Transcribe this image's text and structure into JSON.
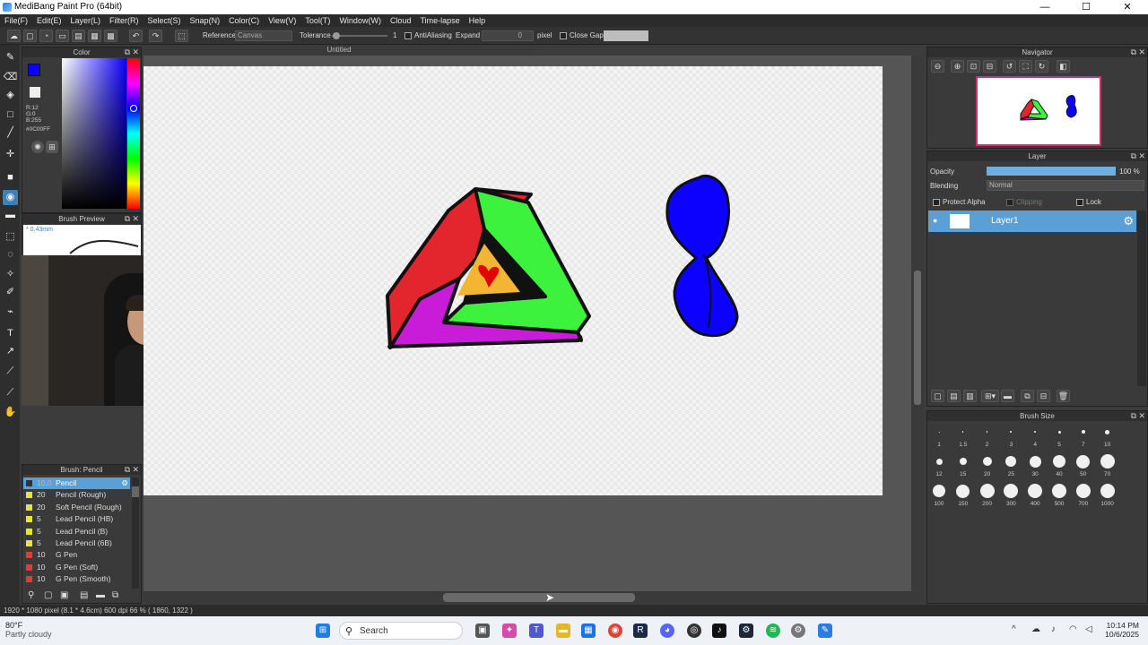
{
  "window": {
    "title": "MediBang Paint Pro (64bit)",
    "min": "—",
    "max": "☐",
    "close": "✕"
  },
  "menu": [
    "File(F)",
    "Edit(E)",
    "Layer(L)",
    "Filter(R)",
    "Select(S)",
    "Snap(N)",
    "Color(C)",
    "View(V)",
    "Tool(T)",
    "Window(W)",
    "Cloud",
    "Time-lapse",
    "Help"
  ],
  "toolbar": {
    "reference_label": "Reference",
    "reference_value": "Canvas",
    "tolerance_label": "Tolerance",
    "tolerance_value": "1",
    "antialiasing_label": "AntiAliasing",
    "expand_label": "Expand",
    "expand_value": "0",
    "expand_unit": "pixel",
    "close_gaps_label": "Close Gaps"
  },
  "color_panel": {
    "title": "Color",
    "r": "R:12",
    "g": "G:0",
    "b": "B:255",
    "hex": "#0C00FF",
    "primary": "#0c00ff"
  },
  "brush_preview": {
    "title": "Brush Preview",
    "size": "0.43mm"
  },
  "document": {
    "tab": "Untitled"
  },
  "brush_panel": {
    "title": "Brush: Pencil",
    "items": [
      {
        "size": "10.0",
        "name": "Pencil",
        "color": "#333333",
        "selected": true
      },
      {
        "size": "20",
        "name": "Pencil (Rough)",
        "color": "#e8e82a"
      },
      {
        "size": "20",
        "name": "Soft Pencil (Rough)",
        "color": "#e8e82a"
      },
      {
        "size": "5",
        "name": "Lead Pencil (HB)",
        "color": "#e8e82a"
      },
      {
        "size": "5",
        "name": "Lead Pencil (B)",
        "color": "#e8e82a"
      },
      {
        "size": "5",
        "name": "Lead Pencil (6B)",
        "color": "#e8e82a"
      },
      {
        "size": "10",
        "name": "G Pen",
        "color": "#e23a3a"
      },
      {
        "size": "10",
        "name": "G Pen (Soft)",
        "color": "#e23a3a"
      },
      {
        "size": "10",
        "name": "G Pen (Smooth)",
        "color": "#e23a3a"
      }
    ]
  },
  "navigator": {
    "title": "Navigator"
  },
  "layer_panel": {
    "title": "Layer",
    "opacity_label": "Opacity",
    "opacity_value": "100 %",
    "opacity": 1.0,
    "blending_label": "Blending",
    "blending_value": "Normal",
    "protect_alpha": "Protect Alpha",
    "clipping": "Clipping",
    "lock": "Lock",
    "layers": [
      {
        "name": "Layer1"
      }
    ]
  },
  "brush_size": {
    "title": "Brush Size",
    "sizes": [
      "1",
      "1.5",
      "2",
      "3",
      "4",
      "5",
      "7",
      "10",
      "12",
      "15",
      "20",
      "25",
      "30",
      "40",
      "50",
      "70",
      "100",
      "150",
      "200",
      "300",
      "400",
      "500",
      "700",
      "1000"
    ]
  },
  "status": {
    "text": "1920 * 1080 pixel   (8.1 * 4.6cm)   600 dpi   66 %   ( 1860, 1322 )"
  },
  "taskbar": {
    "weather_temp": "80°F",
    "weather_desc": "Partly cloudy",
    "search": "Search",
    "time": "10:14 PM",
    "date": "10/6/2025"
  },
  "colors": {
    "accent": "#5aa0d6",
    "panel": "#3a3a3a",
    "triangle_red": "#e3262e",
    "triangle_green": "#3cf23c",
    "triangle_magenta": "#c81cd8",
    "blob_blue": "#0c00ff"
  }
}
